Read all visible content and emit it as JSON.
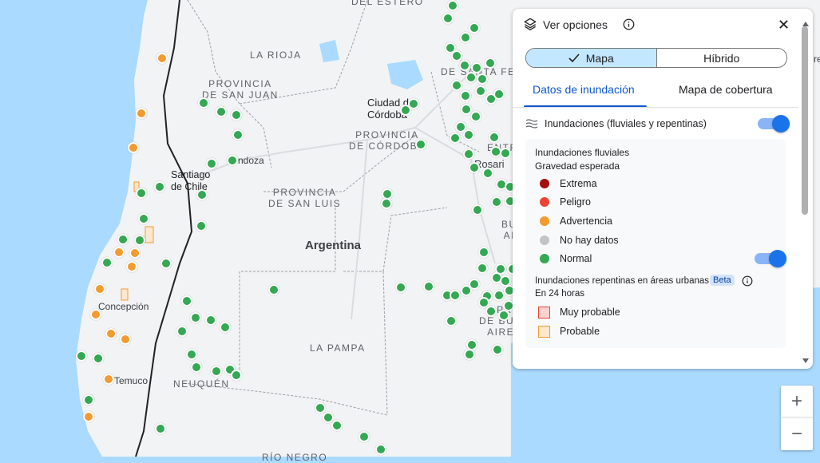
{
  "map": {
    "labels": {
      "la_rioja": "LA RIOJA",
      "prov_san_juan": "PROVINCIA\nDE SAN JUAN",
      "ciudad_cordoba": "Ciudad de\nCórdoba",
      "prov_cordoba": "PROVINCIA\nDE CÓRDOBA",
      "mendoza": "ndoza",
      "santiago": "Santiago\nde Chile",
      "prov_san_luis": "PROVINCIA\nDE SAN LUIS",
      "argentina": "Argentina",
      "concepcion": "Concepción",
      "la_pampa": "LA PAMPA",
      "temuco": "Temuco",
      "neuquen": "NEUQUÉN",
      "rosario": "Rosari",
      "del_estero": "DEL ESTERO",
      "santa_fe_frag": "DE SANTA FE",
      "entre_frag": "ENTR",
      "buenos_frag": "BU\nAI",
      "prov_bsas_frag": "PR\nDE BUEN\nAIRES",
      "rio_negro": "RÍO NEGRO",
      "right_edge": "re"
    }
  },
  "panel": {
    "title": "Ver opciones",
    "segment_mapa": "Mapa",
    "segment_hibrido": "Híbrido",
    "tab_flood": "Datos de inundación",
    "tab_coverage": "Mapa de cobertura",
    "layer_label": "Inundaciones (fluviales y repentinas)",
    "riverine_title": "Inundaciones fluviales",
    "riverine_sub": "Gravedad esperada",
    "legend": [
      {
        "label": "Extrema",
        "color": "#a50e0e"
      },
      {
        "label": "Peligro",
        "color": "#ea4335"
      },
      {
        "label": "Advertencia",
        "color": "#f29b30"
      },
      {
        "label": "No hay datos",
        "color": "#c4c4c4"
      },
      {
        "label": "Normal",
        "color": "#34a853"
      }
    ],
    "flash_title": "Inundaciones repentinas en áreas urbanas",
    "beta": "Beta",
    "flash_sub": "En 24 horas",
    "flash_legend": [
      {
        "label": "Muy probable"
      },
      {
        "label": "Probable"
      }
    ]
  },
  "zoom": {
    "in": "+",
    "out": "−"
  },
  "icons": {
    "layers": "layers-icon",
    "info": "info-icon",
    "close": "close-icon",
    "check": "check-icon",
    "waves": "waves-icon"
  }
}
